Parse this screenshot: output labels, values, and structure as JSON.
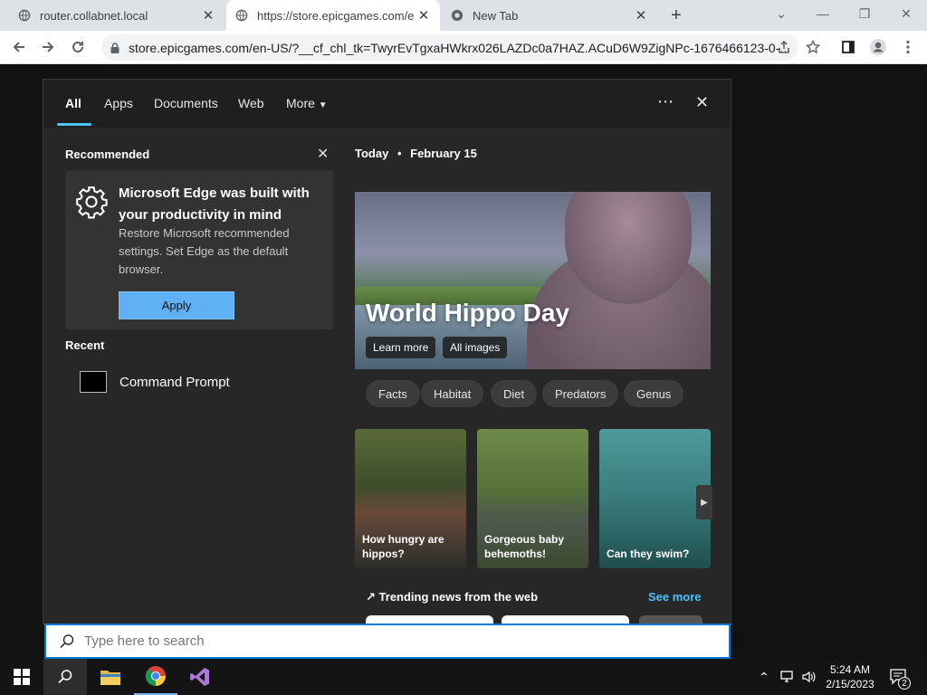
{
  "browser": {
    "tabs": [
      {
        "title": "router.collabnet.local",
        "active": false
      },
      {
        "title": "https://store.epicgames.com/en-",
        "active": true
      },
      {
        "title": "New Tab",
        "active": false
      }
    ],
    "new_tab_glyph": "+",
    "url": "store.epicgames.com/en-US/?__cf_chl_tk=TwyrEvTgxaHWkrx026LAZDc0a7HAZ.ACuD6W9ZigNPc-1676466123-0-..."
  },
  "search_panel": {
    "tabs": [
      "All",
      "Apps",
      "Documents",
      "Web",
      "More"
    ],
    "more_glyph": "⋯",
    "close_glyph": "✕",
    "recommended": {
      "label": "Recommended",
      "title": "Microsoft Edge was built with your productivity in mind",
      "description": "Restore Microsoft recommended settings. Set Edge as the default browser.",
      "button": "Apply"
    },
    "recent": {
      "label": "Recent",
      "items": [
        "Command Prompt"
      ]
    },
    "today": {
      "label": "Today",
      "separator": "•",
      "date": "February 15"
    },
    "hero": {
      "title": "World Hippo Day",
      "learn_more": "Learn more",
      "all_images": "All images"
    },
    "chips": [
      "Facts",
      "Habitat",
      "Diet",
      "Predators",
      "Genus"
    ],
    "thumbnails": [
      {
        "caption": "How hungry are hippos?"
      },
      {
        "caption": "Gorgeous baby behemoths!"
      },
      {
        "caption": "Can they swim?"
      }
    ],
    "trending_label": "Trending news from the web",
    "see_more": "See more"
  },
  "searchbox": {
    "placeholder": "Type here to search"
  },
  "taskbar": {
    "time": "5:24 AM",
    "date": "2/15/2023",
    "notification_count": "2"
  },
  "colors": {
    "accent": "#4cc2ff",
    "apply_button": "#60b0f4",
    "search_border": "#0078d4"
  }
}
